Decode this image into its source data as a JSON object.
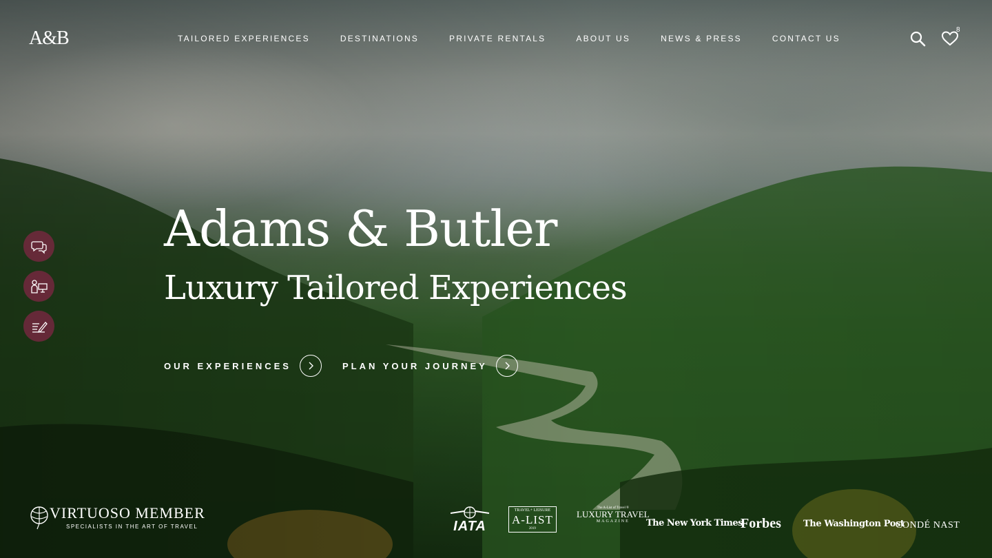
{
  "brand": {
    "logo": "A&B"
  },
  "nav": {
    "items": [
      {
        "label": "TAILORED EXPERIENCES"
      },
      {
        "label": "DESTINATIONS"
      },
      {
        "label": "PRIVATE RENTALS"
      },
      {
        "label": "ABOUT US"
      },
      {
        "label": "NEWS & PRESS"
      },
      {
        "label": "CONTACT US"
      }
    ],
    "search_icon": "search-icon",
    "favorites_icon": "heart-icon",
    "favorites_count": "8"
  },
  "side_actions": [
    {
      "icon": "chat-icon"
    },
    {
      "icon": "consultant-icon"
    },
    {
      "icon": "enquiry-form-icon"
    }
  ],
  "hero": {
    "title": "Adams & Butler",
    "subtitle": "Luxury Tailored Experiences",
    "cta_primary": "OUR EXPERIENCES",
    "cta_secondary": "PLAN YOUR JOURNEY",
    "accent_color": "#73283e"
  },
  "footer": {
    "virtuoso_title": "VIRTUOSO MEMBER",
    "virtuoso_tagline": "SPECIALISTS IN THE ART OF TRAVEL",
    "press": {
      "iata": "IATA",
      "alist_top": "TRAVEL+ LEISURE",
      "alist_main": "A-LIST",
      "alist_year": "2019",
      "ltm_top": "The A-List of Travel ®",
      "ltm_main": "LUXURY TRAVEL",
      "ltm_bottom": "MAGAZINE",
      "nyt": "The New York Times",
      "forbes": "Forbes",
      "wapo": "The Washington Post",
      "conde": "CONDÉ NAST"
    }
  }
}
